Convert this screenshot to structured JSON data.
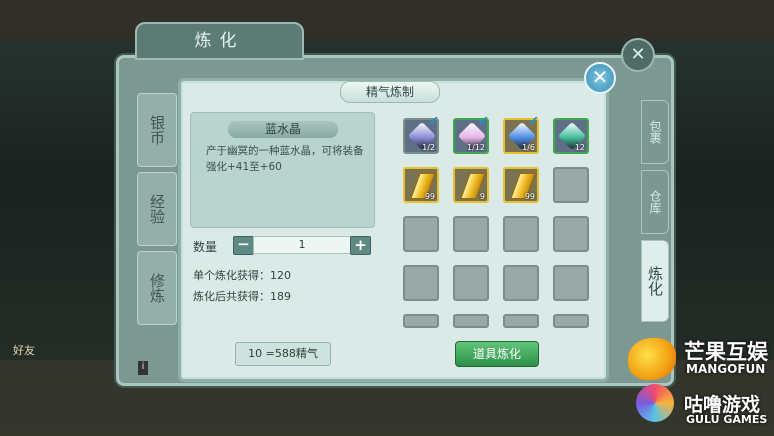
{
  "background_panel": {
    "title": "炼化",
    "left_tabs": [
      "银币",
      "经验",
      "修炼"
    ],
    "right_tabs": [
      "包裹",
      "仓库",
      "炼化"
    ],
    "active_right_tab": "炼化"
  },
  "dialog": {
    "title": "精气炼制",
    "close_icon": "close-icon",
    "item": {
      "name": "蓝水晶",
      "description": "产于幽冥的一种蓝水晶，可将装备强化+41至+60"
    },
    "quantity": {
      "label": "数量",
      "value": "1",
      "minus": "−",
      "plus": "+"
    },
    "stats": {
      "single_label": "单个炼化获得：120",
      "total_label": "炼化后共获得：189"
    },
    "inventory": [
      {
        "icon": "purple-crystal-icon",
        "count": "1/2",
        "checked": true,
        "border": "none",
        "color": "#8c8fd8"
      },
      {
        "icon": "pink-crystal-icon",
        "count": "1/12",
        "checked": true,
        "border": "green",
        "color": "#e4b6e8"
      },
      {
        "icon": "blue-crystal-icon",
        "count": "1/6",
        "checked": true,
        "border": "yellow",
        "color": "#4f8fe6"
      },
      {
        "icon": "green-crystal-icon",
        "count": "12",
        "checked": false,
        "border": "green",
        "color": "#43c09c"
      },
      {
        "icon": "gold-ingot-icon",
        "count": "99",
        "checked": false,
        "border": "yellow",
        "color": "#f0c02a"
      },
      {
        "icon": "gold-ingot-icon",
        "count": "9",
        "checked": false,
        "border": "yellow",
        "color": "#f0c02a"
      },
      {
        "icon": "gold-ingot-icon",
        "count": "99",
        "checked": false,
        "border": "yellow",
        "color": "#f0c02a"
      }
    ],
    "cost_button": "10 =588精气",
    "craft_button": "道具炼化"
  },
  "hud": {
    "friend_label": "好友",
    "info_icon": "i"
  },
  "watermarks": {
    "mango": "芒果互娱",
    "mango_en": "MANGOFUN",
    "gulu": "咕噜游戏",
    "gulu_en": "GULU GAMES"
  }
}
